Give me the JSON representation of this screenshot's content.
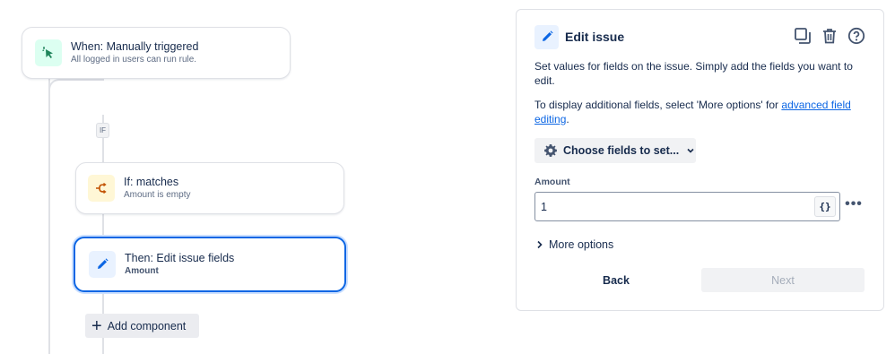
{
  "flow": {
    "trigger": {
      "title": "When: Manually triggered",
      "subtitle": "All logged in users can run rule.",
      "icon": "cursor-click-icon"
    },
    "branch_badge": "IF",
    "condition": {
      "title": "If: matches",
      "subtitle": "Amount is empty",
      "icon": "branch-icon"
    },
    "action": {
      "title": "Then: Edit issue fields",
      "subtitle": "Amount",
      "icon": "pencil-icon"
    },
    "add_component_label": "Add component"
  },
  "panel": {
    "title": "Edit issue",
    "description": "Set values for fields on the issue. Simply add the fields you want to edit.",
    "more_info_prefix": "To display additional fields, select 'More options' for ",
    "more_info_link": "advanced field editing",
    "more_info_suffix": ".",
    "choose_fields_label": "Choose fields to set...",
    "field": {
      "label": "Amount",
      "value": "1",
      "smart_value_button": "{}"
    },
    "more_options_label": "More options",
    "back_label": "Back",
    "next_label": "Next"
  },
  "colors": {
    "accent": "#0c66e4",
    "trigger_bg": "#dcfff1",
    "condition_bg": "#fff7d6"
  }
}
